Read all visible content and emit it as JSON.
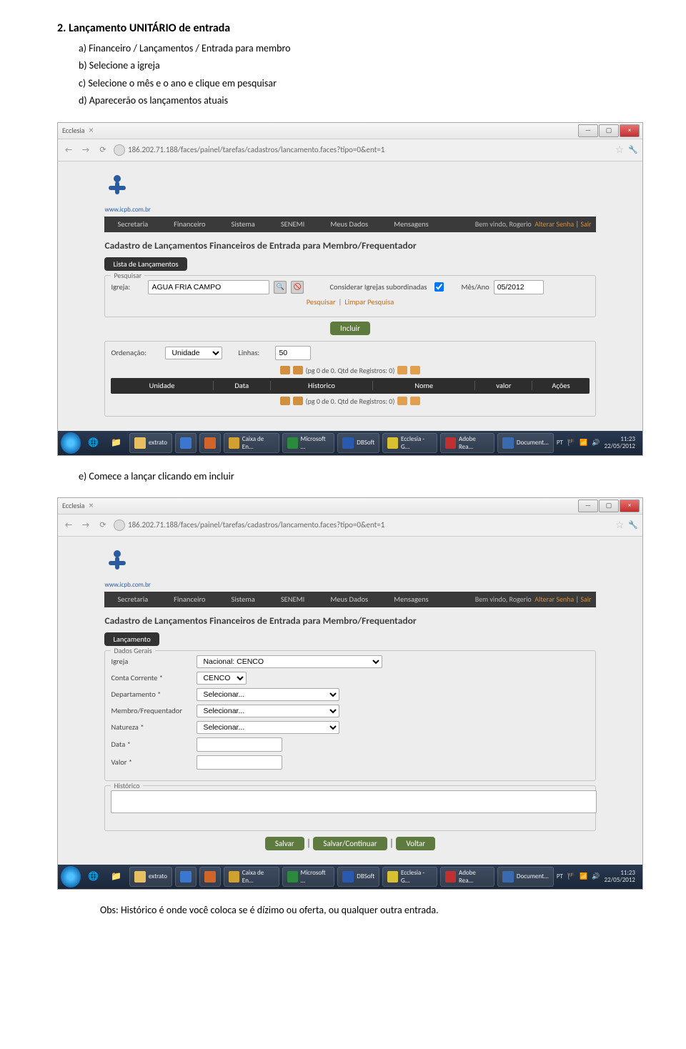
{
  "doc": {
    "heading": "2. Lançamento UNITÁRIO de entrada",
    "step_a": "a) Financeiro / Lançamentos / Entrada para membro",
    "step_b": "b) Selecione a igreja",
    "step_c": "c) Selecione o mês e o ano e clique em pesquisar",
    "step_d": "d) Aparecerão os lançamentos atuais",
    "step_e": "e) Comece a lançar clicando em incluir",
    "obs": "Obs: Histórico é onde você coloca se é dízimo ou oferta, ou qualquer outra entrada."
  },
  "browser": {
    "tab": "Ecclesia",
    "url": "186.202.71.188/faces/painel/tarefas/cadastros/lancamento.faces?tipo=0&ent=1",
    "logo_txt": "www.icpb.com.br"
  },
  "nav": {
    "items": [
      "Secretaria",
      "Financeiro",
      "Sistema",
      "SENEMI",
      "Meus Dados",
      "Mensagens"
    ],
    "welcome": "Bem vindo, Rogerio",
    "alterar": "Alterar Senha",
    "sair": "Sair"
  },
  "shot1": {
    "title": "Cadastro de Lançamentos Financeiros de Entrada para Membro/Frequentador",
    "tab": "Lista de Lançamentos",
    "pesq_leg": "Pesquisar",
    "igreja_lbl": "Igreja:",
    "igreja_val": "AGUA FRIA CAMPO",
    "consid_lbl": "Considerar Igrejas subordinadas",
    "mesano_lbl": "Mês/Ano",
    "mesano_val": "05/2012",
    "pesq_link": "Pesquisar",
    "limpar_link": "Limpar Pesquisa",
    "incluir": "Incluir",
    "ord_lbl": "Ordenação:",
    "ord_val": "Unidade",
    "linhas_lbl": "Linhas:",
    "linhas_val": "50",
    "pager": "(pg 0 de 0. Qtd de Registros: 0)",
    "cols": [
      "Unidade",
      "Data",
      "Historico",
      "Nome",
      "valor",
      "Ações"
    ]
  },
  "shot2": {
    "title": "Cadastro de Lançamentos Financeiros de Entrada para Membro/Frequentador",
    "tab": "Lançamento",
    "dados_leg": "Dados Gerais",
    "igreja_lbl": "Igreja",
    "igreja_val": "Nacional: CENCO",
    "conta_lbl": "Conta Corrente *",
    "conta_val": "CENCO",
    "depto_lbl": "Departamento *",
    "depto_val": "Selecionar...",
    "membro_lbl": "Membro/Frequentador",
    "membro_val": "Selecionar...",
    "nat_lbl": "Natureza *",
    "nat_val": "Selecionar...",
    "data_lbl": "Data *",
    "valor_lbl": "Valor *",
    "hist_leg": "Histórico",
    "salvar": "Salvar",
    "salvarcont": "Salvar/Continuar",
    "voltar": "Voltar"
  },
  "taskbar": {
    "apps": [
      {
        "name": "extrato",
        "color": "#e6c060"
      },
      {
        "name": "",
        "color": "#3a78d0"
      },
      {
        "name": "",
        "color": "#d0652a"
      },
      {
        "name": "Caixa de En...",
        "color": "#d0a030"
      },
      {
        "name": "Microsoft ...",
        "color": "#2b8a3e"
      },
      {
        "name": "DBSoft",
        "color": "#2a5ab0"
      },
      {
        "name": "Ecclesia - G...",
        "color": "#d8c030"
      },
      {
        "name": "Adobe Rea...",
        "color": "#c03030"
      },
      {
        "name": "Document...",
        "color": "#3a6ab0"
      }
    ],
    "lang": "PT",
    "time": "11:23",
    "date": "22/05/2012"
  }
}
